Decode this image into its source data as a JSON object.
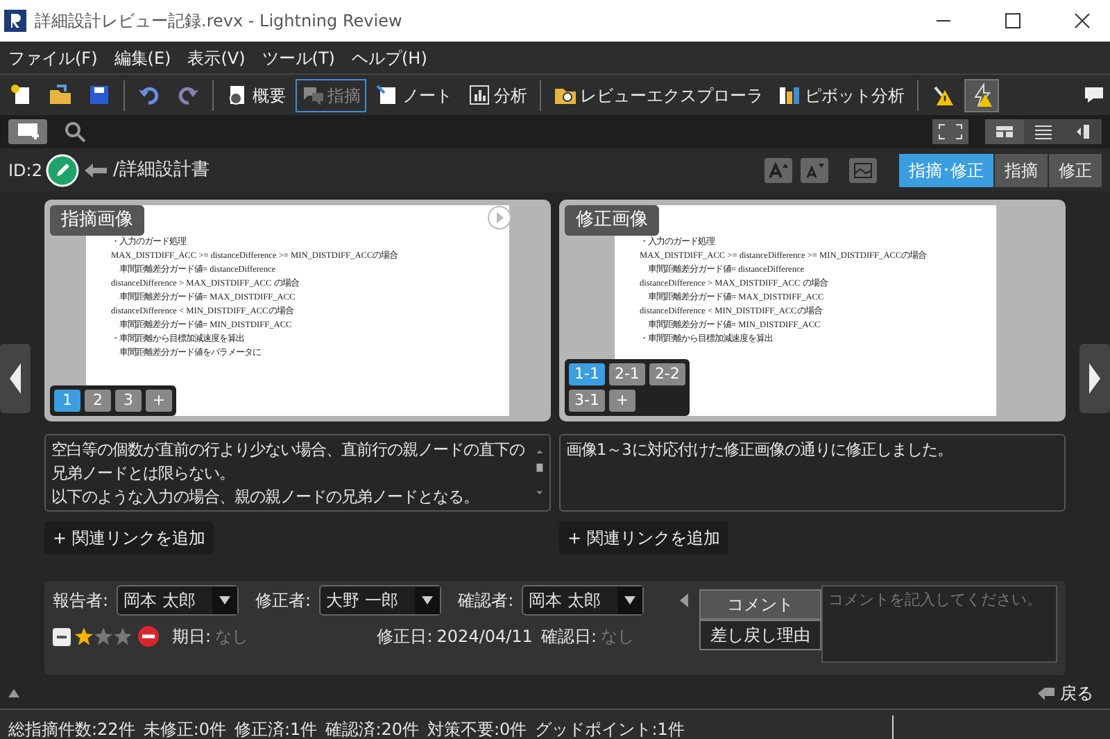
{
  "window": {
    "title": "詳細設計レビュー記録.revx  - Lightning Review"
  },
  "menu": [
    "ファイル(F)",
    "編集(E)",
    "表示(V)",
    "ツール(T)",
    "ヘルプ(H)"
  ],
  "toolbar": [
    {
      "kind": "new",
      "selected": false
    },
    {
      "kind": "open",
      "selected": false
    },
    {
      "kind": "save",
      "selected": false
    },
    {
      "kind": "sep"
    },
    {
      "kind": "undo",
      "selected": false
    },
    {
      "kind": "redo",
      "selected": false
    },
    {
      "kind": "sep"
    },
    {
      "kind": "overview",
      "label": "概要",
      "selected": false
    },
    {
      "kind": "issue",
      "label": "指摘",
      "selected": true
    },
    {
      "kind": "note",
      "label": "ノート",
      "selected": false
    },
    {
      "kind": "chart",
      "label": "分析",
      "selected": false
    },
    {
      "kind": "sep"
    },
    {
      "kind": "explorer",
      "label": "レビューエクスプローラ",
      "selected": false
    },
    {
      "kind": "pivot",
      "label": "ピボット分析",
      "selected": false
    },
    {
      "kind": "sep"
    },
    {
      "kind": "warn",
      "selected": false
    },
    {
      "kind": "bolt",
      "selected": true
    }
  ],
  "issue": {
    "id": "ID:2",
    "path": "/詳細設計書"
  },
  "view_tabs": [
    {
      "label": "指摘･修正",
      "selected": true
    },
    {
      "label": "指摘",
      "selected": false
    },
    {
      "label": "修正",
      "selected": false
    }
  ],
  "panels": [
    {
      "label": "指摘画像",
      "pages": [
        {
          "label": "1",
          "selected": true
        },
        {
          "label": "2",
          "selected": false
        },
        {
          "label": "3",
          "selected": false
        },
        {
          "label": "+",
          "selected": false
        }
      ],
      "doc_lines": [
        "・入力のガード処理",
        "MAX_DISTDIFF_ACC >= distanceDifference >= MIN_DISTDIFF_ACCの場合",
        "車間距離差分ガード値= distanceDifference",
        "distanceDifference > MAX_DISTDIFF_ACC の場合",
        "車間距離差分ガード値= MAX_DISTDIFF_ACC",
        "distanceDifference < MIN_DISTDIFF_ACCの場合",
        "車間距離差分ガード値= MIN_DISTDIFF_ACC",
        "・車間距離から目標加減速度を算出",
        "車間距離差分ガード値をパラメータに"
      ],
      "text": [
        "空白等の個数が直前の行より少ない場合、直前行の親ノードの直下の兄弟ノードとは限らない。",
        "以下のような入力の場合、親の親ノードの兄弟ノードとなる。"
      ],
      "link": "+ 関連リンクを追加"
    },
    {
      "label": "修正画像",
      "pages": [
        {
          "label": "1-1",
          "selected": true
        },
        {
          "label": "2-1",
          "selected": false
        },
        {
          "label": "2-2",
          "selected": false
        },
        {
          "label": "3-1",
          "selected": false
        },
        {
          "label": "+",
          "selected": false
        }
      ],
      "doc_lines": [
        "・入力のガード処理",
        "MAX_DISTDIFF_ACC >= distanceDifference >= MIN_DISTDIFF_ACCの場合",
        "車間距離差分ガード値= distanceDifference",
        "distanceDifference > MAX_DISTDIFF_ACC の場合",
        "車間距離差分ガード値= MAX_DISTDIFF_ACC",
        "distanceDifference < MIN_DISTDIFF_ACCの場合",
        "車間距離差分ガード値= MIN_DISTDIFF_ACC",
        "・車間距離から目標加減速度を算出"
      ],
      "text": [
        "画像1～3に対応付けた修正画像の通りに修正しました。"
      ],
      "link": "+ 関連リンクを追加"
    }
  ],
  "people": [
    {
      "label": "報告者:",
      "value": "岡本 太郎"
    },
    {
      "label": "修正者:",
      "value": "大野 一郎"
    },
    {
      "label": "確認者:",
      "value": "岡本 太郎"
    }
  ],
  "stars": 1,
  "dates": [
    {
      "label": "期日:",
      "value": "なし",
      "set": false
    },
    {
      "label": "修正日:",
      "value": "2024/04/11",
      "set": true
    },
    {
      "label": "確認日:",
      "value": "なし",
      "set": false
    }
  ],
  "comment_tabs": [
    {
      "label": "コメント",
      "selected": true
    },
    {
      "label": "差し戻し理由",
      "selected": false
    }
  ],
  "comment": {
    "placeholder": "コメントを記入してください。"
  },
  "back": "戻る",
  "status_bar": [
    "総指摘件数:22件",
    "未修正:0件",
    "修正済:1件",
    "確認済:20件",
    "対策不要:0件",
    "グッドポイント:1件"
  ]
}
